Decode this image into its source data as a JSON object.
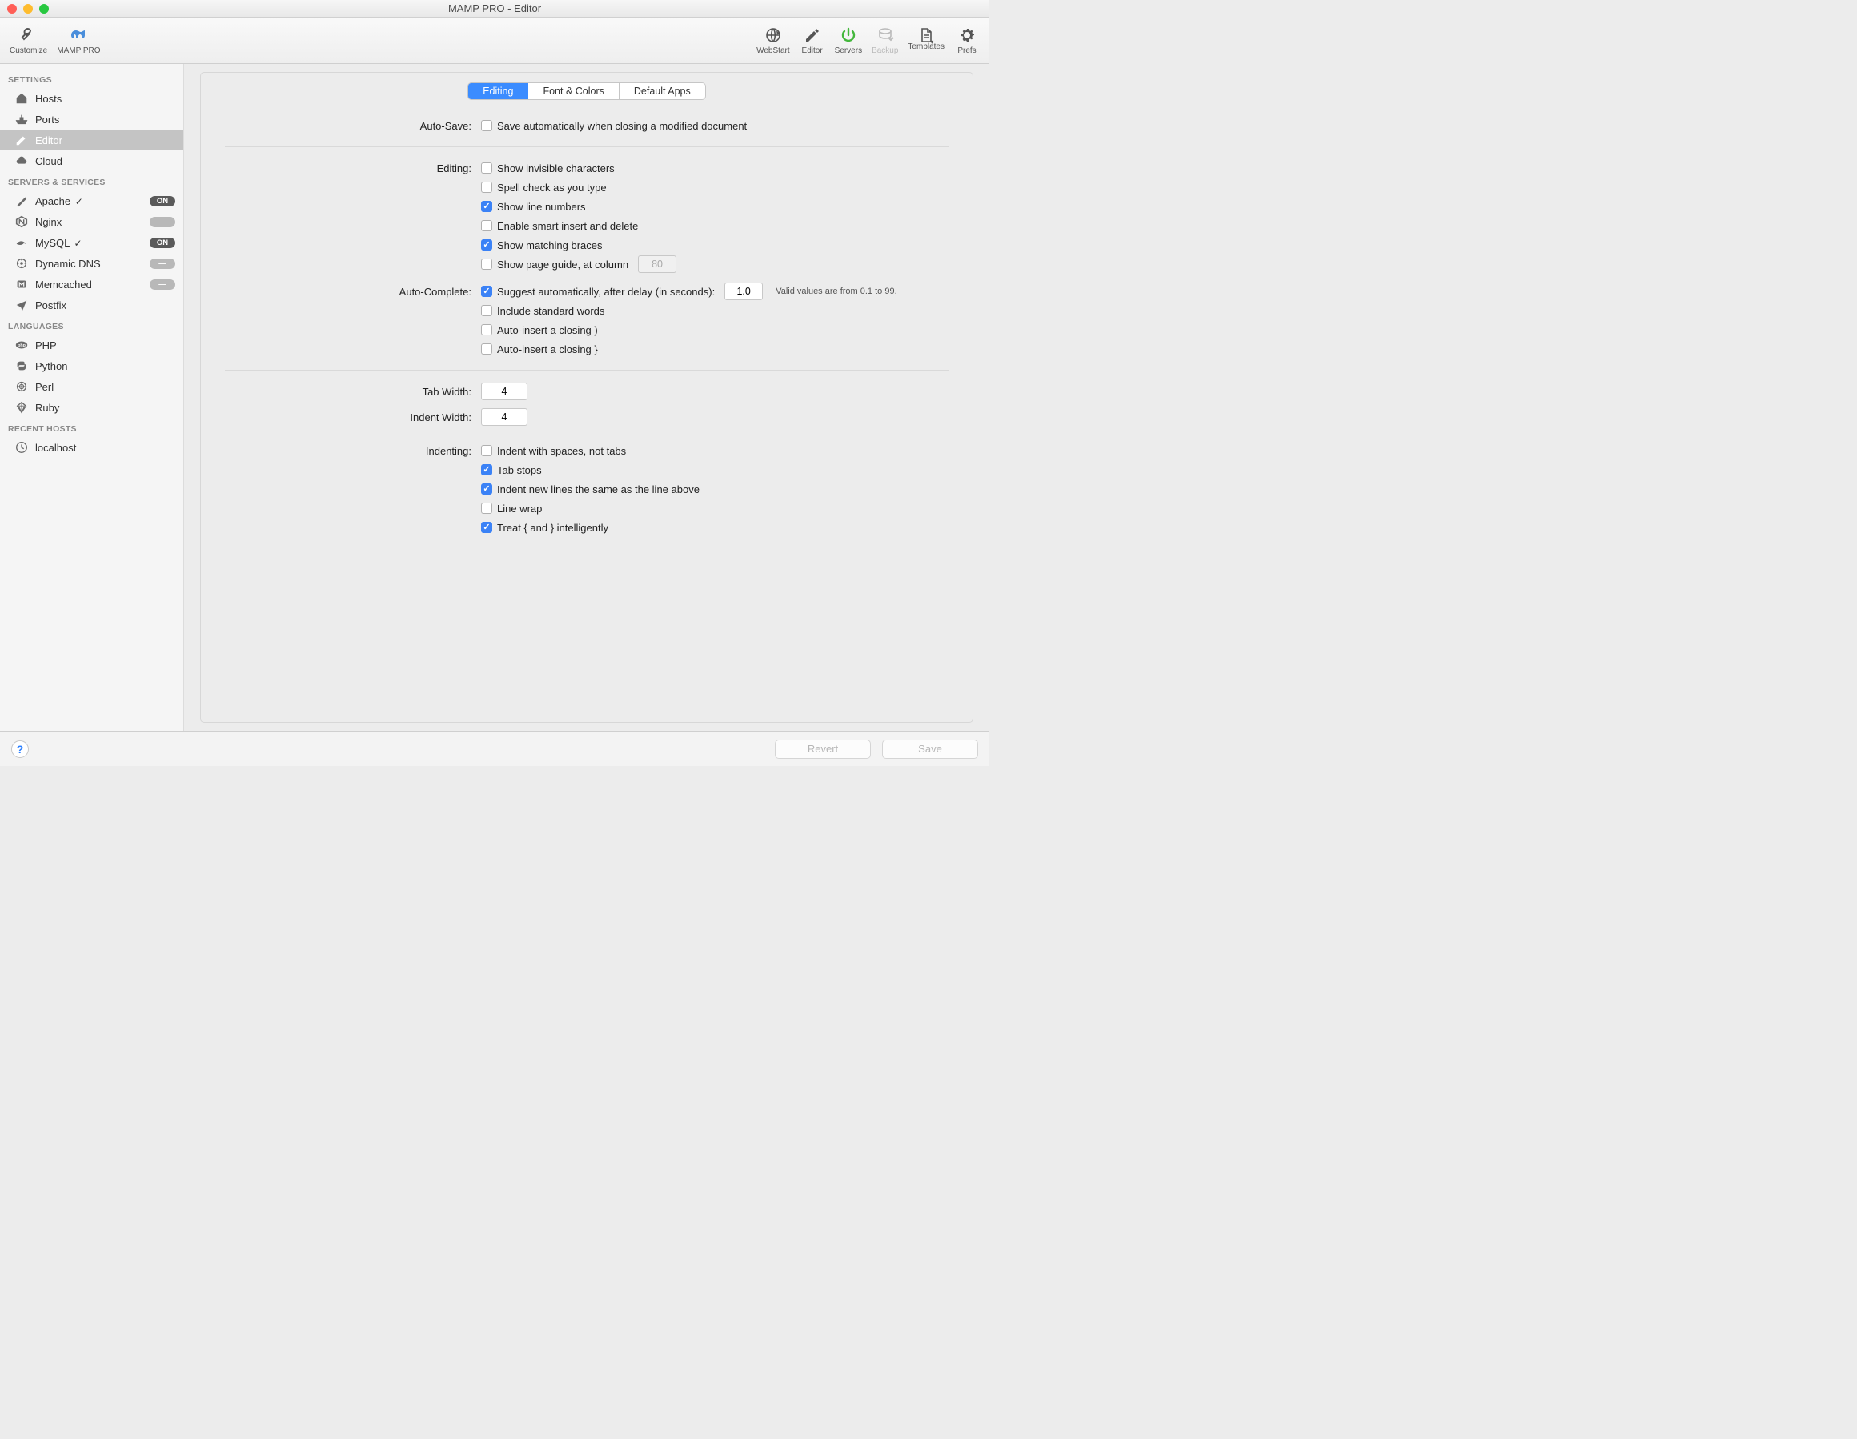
{
  "window": {
    "title": "MAMP PRO - Editor"
  },
  "toolbar": {
    "left": [
      {
        "id": "customize",
        "label": "Customize"
      },
      {
        "id": "mamp-pro",
        "label": "MAMP PRO"
      }
    ],
    "right": [
      {
        "id": "webstart",
        "label": "WebStart"
      },
      {
        "id": "editor",
        "label": "Editor"
      },
      {
        "id": "servers",
        "label": "Servers"
      },
      {
        "id": "backup",
        "label": "Backup",
        "disabled": true
      },
      {
        "id": "templates",
        "label": "Templates"
      },
      {
        "id": "prefs",
        "label": "Prefs"
      }
    ]
  },
  "sidebar": {
    "groups": [
      {
        "header": "SETTINGS",
        "items": [
          {
            "label": "Hosts",
            "icon": "home"
          },
          {
            "label": "Ports",
            "icon": "ship"
          },
          {
            "label": "Editor",
            "icon": "pencil",
            "selected": true
          },
          {
            "label": "Cloud",
            "icon": "cloud"
          }
        ]
      },
      {
        "header": "SERVERS & SERVICES",
        "items": [
          {
            "label": "Apache",
            "icon": "feather",
            "check": true,
            "pill": "ON",
            "pillOn": true
          },
          {
            "label": "Nginx",
            "icon": "nginx",
            "pill": "—"
          },
          {
            "label": "MySQL",
            "icon": "dolphin",
            "check": true,
            "pill": "ON",
            "pillOn": true
          },
          {
            "label": "Dynamic DNS",
            "icon": "dns",
            "pill": "—"
          },
          {
            "label": "Memcached",
            "icon": "memcached",
            "pill": "—"
          },
          {
            "label": "Postfix",
            "icon": "plane"
          }
        ]
      },
      {
        "header": "LANGUAGES",
        "items": [
          {
            "label": "PHP",
            "icon": "php"
          },
          {
            "label": "Python",
            "icon": "python"
          },
          {
            "label": "Perl",
            "icon": "perl"
          },
          {
            "label": "Ruby",
            "icon": "ruby"
          }
        ]
      },
      {
        "header": "RECENT HOSTS",
        "items": [
          {
            "label": "localhost",
            "icon": "clock"
          }
        ]
      }
    ]
  },
  "tabs": [
    {
      "label": "Editing",
      "active": true
    },
    {
      "label": "Font & Colors"
    },
    {
      "label": "Default Apps"
    }
  ],
  "form": {
    "autosave": {
      "label": "Auto-Save:",
      "opt": "Save automatically when closing a modified document",
      "checked": false
    },
    "editing": {
      "label": "Editing:",
      "opts": [
        {
          "text": "Show invisible characters",
          "checked": false
        },
        {
          "text": "Spell check as you type",
          "checked": false
        },
        {
          "text": "Show line numbers",
          "checked": true
        },
        {
          "text": "Enable smart insert and delete",
          "checked": false
        },
        {
          "text": "Show matching braces",
          "checked": true
        },
        {
          "text": "Show page guide, at column",
          "checked": false,
          "input": "80",
          "inputDisabled": true
        }
      ]
    },
    "autocomplete": {
      "label": "Auto-Complete:",
      "opts": [
        {
          "text": "Suggest automatically, after delay (in seconds):",
          "checked": true,
          "input": "1.0",
          "hint": "Valid values are from 0.1 to 99."
        },
        {
          "text": "Include standard words",
          "checked": false
        },
        {
          "text": "Auto-insert a closing )",
          "checked": false
        },
        {
          "text": "Auto-insert a closing }",
          "checked": false
        }
      ]
    },
    "tabwidth": {
      "label": "Tab Width:",
      "value": "4"
    },
    "indentwidth": {
      "label": "Indent Width:",
      "value": "4"
    },
    "indenting": {
      "label": "Indenting:",
      "opts": [
        {
          "text": "Indent with spaces, not tabs",
          "checked": false
        },
        {
          "text": "Tab stops",
          "checked": true
        },
        {
          "text": "Indent new lines the same as the line above",
          "checked": true
        },
        {
          "text": "Line wrap",
          "checked": false
        },
        {
          "text": "Treat { and } intelligently",
          "checked": true
        }
      ]
    }
  },
  "footer": {
    "help": "?",
    "revert": "Revert",
    "save": "Save"
  }
}
